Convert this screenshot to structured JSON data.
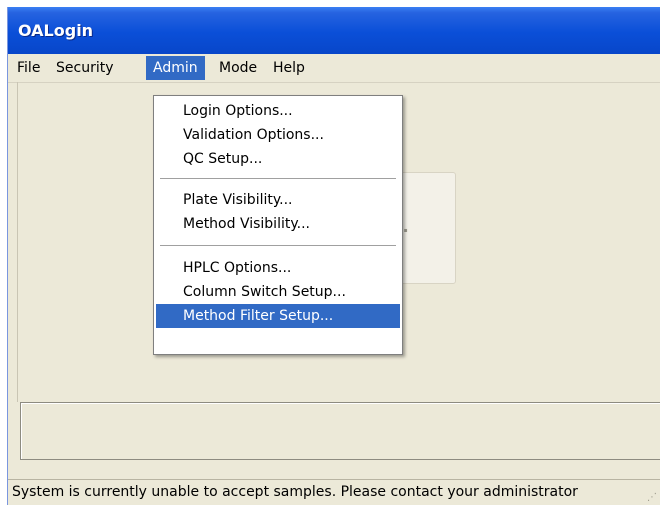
{
  "window": {
    "title": "OALogin"
  },
  "menubar": {
    "items": [
      {
        "label": "File"
      },
      {
        "label": "Security"
      },
      {
        "label": "Admin",
        "active": true
      },
      {
        "label": "Mode"
      },
      {
        "label": "Help"
      }
    ]
  },
  "admin_menu": {
    "items": [
      {
        "label": "Login Options..."
      },
      {
        "label": "Validation Options..."
      },
      {
        "label": "QC Setup..."
      },
      {
        "label": "Plate Visibility..."
      },
      {
        "label": "Method Visibility..."
      },
      {
        "label": "HPLC Options..."
      },
      {
        "label": "Column Switch Setup..."
      },
      {
        "label": "Method Filter Setup...",
        "highlighted": true
      }
    ]
  },
  "background": {
    "obscured_button_fragment": "s..."
  },
  "statusbar": {
    "message": "System is currently unable to accept samples. Please contact your administrator"
  },
  "colors": {
    "titlebar": "#0a4fd8",
    "highlight": "#316ac5",
    "window_bg": "#ece9d8"
  }
}
